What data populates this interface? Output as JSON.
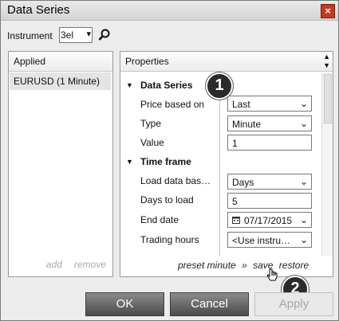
{
  "window": {
    "title": "Data Series",
    "close_glyph": "×"
  },
  "instrument": {
    "label": "Instrument",
    "value": "3el",
    "chevron": "▾"
  },
  "applied_panel": {
    "header": "Applied",
    "items": [
      "EURUSD (1 Minute)"
    ],
    "add_label": "add",
    "remove_label": "remove"
  },
  "properties_panel": {
    "header": "Properties",
    "sections": [
      {
        "title": "Data Series",
        "rows": [
          {
            "label": "Price based on",
            "value": "Last",
            "control": "select"
          },
          {
            "label": "Type",
            "value": "Minute",
            "control": "select"
          },
          {
            "label": "Value",
            "value": "1",
            "control": "input"
          }
        ]
      },
      {
        "title": "Time frame",
        "rows": [
          {
            "label": "Load data bas…",
            "value": "Days",
            "control": "select"
          },
          {
            "label": "Days to load",
            "value": "5",
            "control": "input"
          },
          {
            "label": "End date",
            "value": "07/17/2015",
            "control": "date"
          },
          {
            "label": "Trading hours",
            "value": "<Use instru…",
            "control": "select"
          }
        ]
      }
    ],
    "footer": {
      "preset": "preset minute",
      "sep": "»",
      "save": "save",
      "restore": "restore"
    }
  },
  "buttons": {
    "ok": "OK",
    "cancel": "Cancel",
    "apply": "Apply"
  },
  "badges": [
    "1",
    "2"
  ]
}
